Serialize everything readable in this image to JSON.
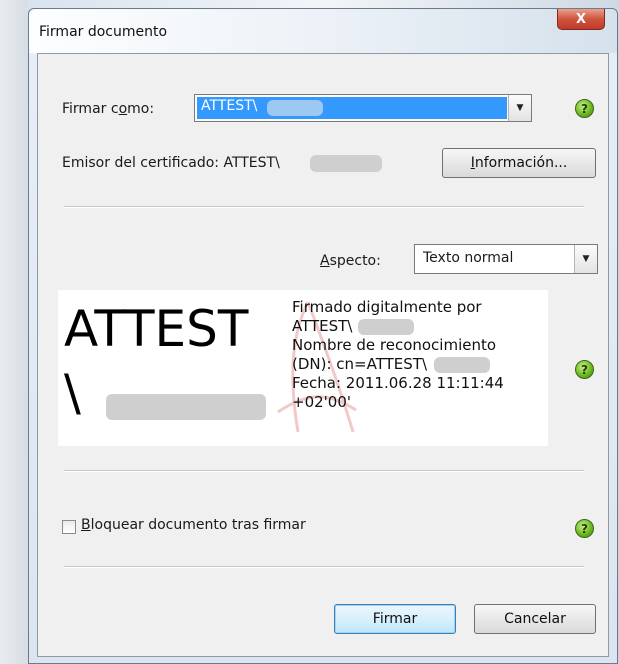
{
  "window": {
    "title": "Firmar documento",
    "close_glyph": "X"
  },
  "sign_as": {
    "label_pre": "Firmar c",
    "label_u": "o",
    "label_post": "mo:",
    "value": "ATTEST\\"
  },
  "issuer": {
    "label": "Emisor del certificado: ATTEST\\",
    "info_button_u": "I",
    "info_button_rest": "nformación..."
  },
  "appearance": {
    "label_u": "A",
    "label_rest": "specto:",
    "value": "Texto normal"
  },
  "preview": {
    "big_line1": "ATTEST",
    "big_line2": "\\",
    "lines": [
      "Firmado digitalmente por",
      "ATTEST\\",
      "Nombre de reconocimiento",
      "(DN): cn=ATTEST\\",
      "Fecha: 2011.06.28 11:11:44",
      "+02'00'"
    ]
  },
  "lock": {
    "label_u": "B",
    "label_rest": "loquear documento tras firmar",
    "checked": false
  },
  "buttons": {
    "sign": "Firmar",
    "cancel": "Cancelar"
  },
  "help_glyph": "?",
  "dropdown_glyph": "▼",
  "colors": {
    "selection": "#3399ff",
    "help_green": "#6fb824",
    "close_red": "#c0392b"
  }
}
